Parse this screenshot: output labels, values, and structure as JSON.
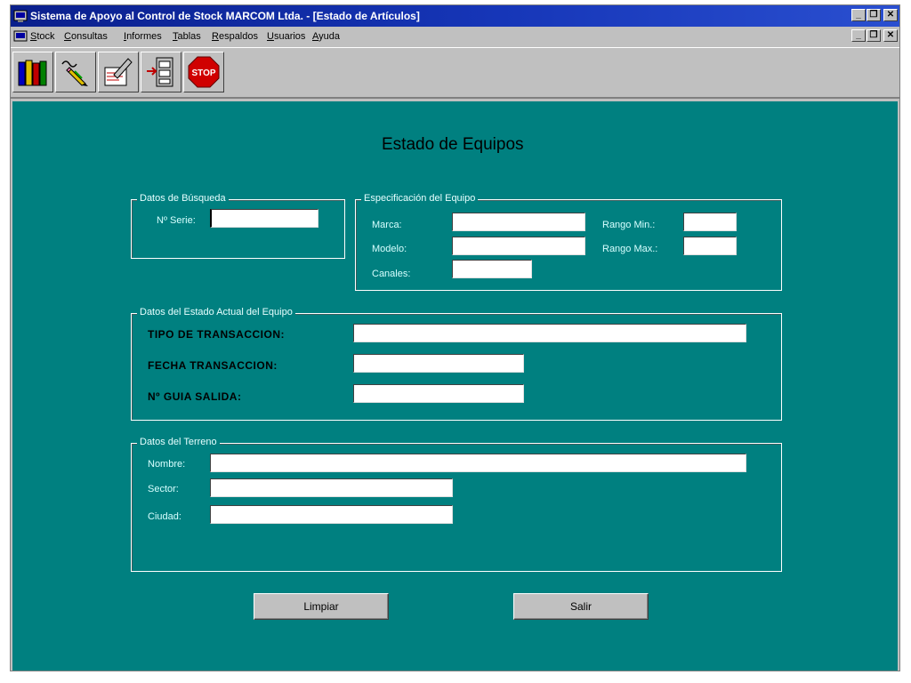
{
  "window": {
    "title": "Sistema de Apoyo al Control de Stock MARCOM Ltda. - [Estado de Artículos]",
    "controls": {
      "minimize": "_",
      "restore": "❐",
      "close": "✕"
    }
  },
  "menu": {
    "items": [
      {
        "label": "Stock"
      },
      {
        "label": "Consultas"
      },
      {
        "label": "Informes"
      },
      {
        "label": "Tablas"
      },
      {
        "label": "Respaldos"
      },
      {
        "label": "Usuarios"
      },
      {
        "label": "Ayuda"
      }
    ],
    "controls": {
      "minimize": "_",
      "restore": "❐",
      "close": "✕"
    }
  },
  "toolbar": {
    "buttons": [
      {
        "icon": "books-icon"
      },
      {
        "icon": "edit-pencil-icon"
      },
      {
        "icon": "document-edit-icon"
      },
      {
        "icon": "file-cabinet-icon"
      },
      {
        "icon": "stop-icon",
        "text": "STOP"
      }
    ]
  },
  "form": {
    "heading": "Estado de Equipos",
    "busqueda": {
      "legend": "Datos de Búsqueda",
      "serie_label": "Nº Serie:",
      "serie_value": ""
    },
    "especificacion": {
      "legend": "Especificación del Equipo",
      "marca_label": "Marca:",
      "modelo_label": "Modelo:",
      "canales_label": "Canales:",
      "rango_min_label": "Rango Min.:",
      "rango_max_label": "Rango Max.:",
      "marca_value": "",
      "modelo_value": "",
      "canales_value": "",
      "rango_min_value": "",
      "rango_max_value": ""
    },
    "estado": {
      "legend": "Datos del Estado Actual del Equipo",
      "tipo_label": "TIPO DE TRANSACCION:",
      "fecha_label": "FECHA TRANSACCION:",
      "guia_label": "Nº GUIA SALIDA:",
      "tipo_value": "",
      "fecha_value": "",
      "guia_value": ""
    },
    "terreno": {
      "legend": "Datos del Terreno",
      "nombre_label": "Nombre:",
      "sector_label": "Sector:",
      "ciudad_label": "Ciudad:",
      "nombre_value": "",
      "sector_value": "",
      "ciudad_value": ""
    },
    "buttons": {
      "limpiar": "Limpiar",
      "salir": "Salir"
    }
  },
  "colors": {
    "client_background": "#008080",
    "titlebar": "#0a1f8c",
    "chrome": "#c0c0c0"
  }
}
